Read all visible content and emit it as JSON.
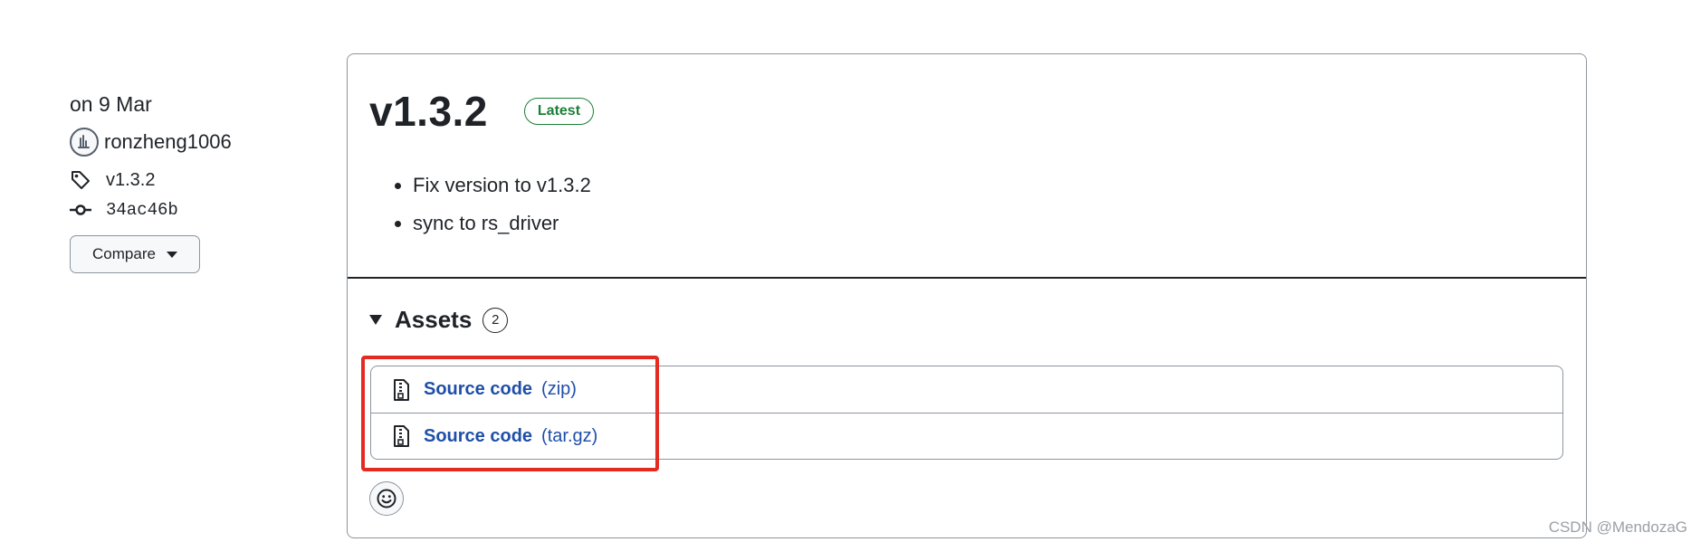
{
  "meta": {
    "date": "on 9 Mar",
    "author": "ronzheng1006",
    "tag": "v1.3.2",
    "commit": "34ac46b",
    "compare_label": "Compare",
    "icons": [
      "avatar",
      "tag-icon",
      "commit-icon",
      "caret-down-icon"
    ]
  },
  "release": {
    "title": "v1.3.2",
    "badge": "Latest",
    "notes": [
      "Fix version to v1.3.2",
      "sync to rs_driver"
    ]
  },
  "assets": {
    "heading": "Assets",
    "count": "2",
    "items": [
      {
        "label": "Source code",
        "ext": "(zip)"
      },
      {
        "label": "Source code",
        "ext": "(tar.gz)"
      }
    ]
  },
  "colors": {
    "badge_green": "#1a7f37",
    "link_blue": "#1f4fa8",
    "highlight_red": "#e32b22",
    "border_gray": "#8c959f"
  },
  "watermark": "CSDN @MendozaG"
}
